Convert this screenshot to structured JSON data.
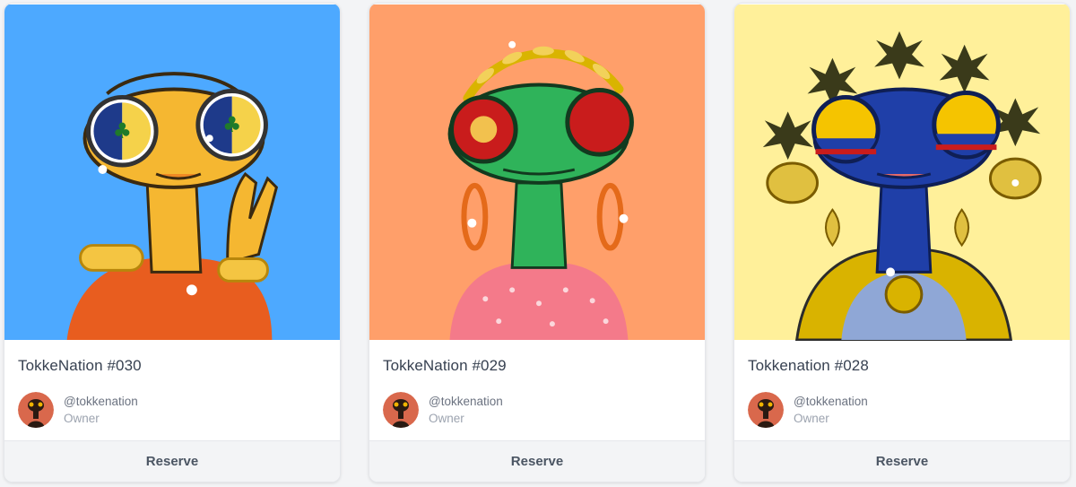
{
  "cards": [
    {
      "title": "TokkeNation #030",
      "owner_handle": "@tokkenation",
      "owner_role": "Owner",
      "action_label": "Reserve",
      "art": {
        "background": "#4da9ff",
        "skin": "#f5b731",
        "lens": "#1e3a8a",
        "outfit": "#e85d1f"
      }
    },
    {
      "title": "TokkeNation #029",
      "owner_handle": "@tokkenation",
      "owner_role": "Owner",
      "action_label": "Reserve",
      "art": {
        "background": "#ff9f6a",
        "skin": "#2fb35a",
        "lens": "#c91c1c",
        "outfit": "#f47a8a"
      }
    },
    {
      "title": "Tokkenation #028",
      "owner_handle": "@tokkenation",
      "owner_role": "Owner",
      "action_label": "Reserve",
      "art": {
        "background": "#fff09a",
        "skin": "#1f3fa8",
        "lens": "#f5c400",
        "outfit": "#d9b300"
      }
    }
  ],
  "avatar_colors": {
    "background": "#d9684c",
    "figure": "#2a1a12",
    "accent": "#f0b400"
  }
}
